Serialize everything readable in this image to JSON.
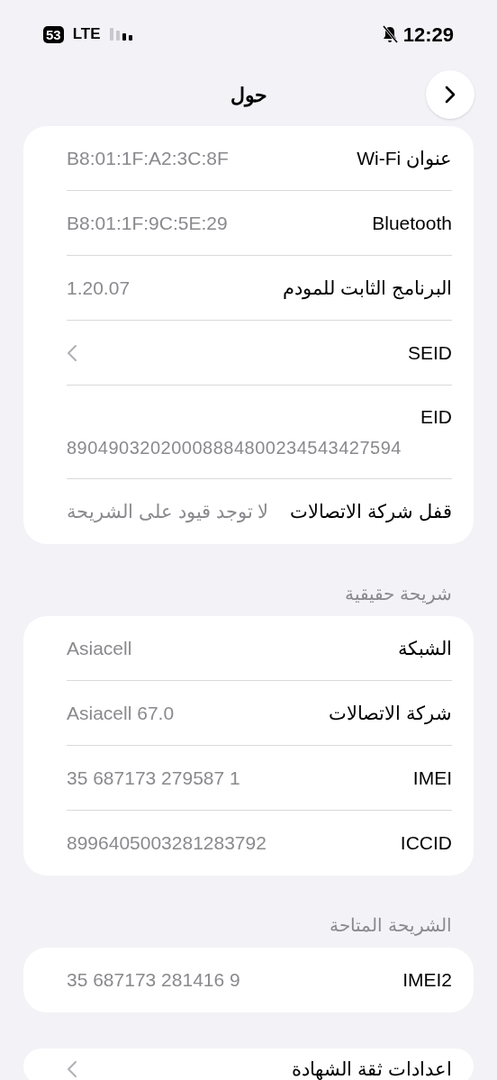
{
  "status_bar": {
    "battery": "53",
    "network": "LTE",
    "time": "12:29"
  },
  "nav": {
    "title": "حول"
  },
  "groups": [
    {
      "rows": [
        {
          "kind": "value",
          "label": "عنوان Wi-Fi",
          "value": "B8:01:1F:A2:3C:8F"
        },
        {
          "kind": "value",
          "label": "Bluetooth",
          "value": "B8:01:1F:9C:5E:29"
        },
        {
          "kind": "value",
          "label": "البرنامج الثابت للمودم",
          "value": "1.20.07"
        },
        {
          "kind": "link",
          "label": "SEID"
        },
        {
          "kind": "stacked",
          "label": "EID",
          "value": "89049032020008884800234543427594"
        },
        {
          "kind": "value",
          "label": "قفل شركة الاتصالات",
          "value": "لا توجد قيود على الشريحة"
        }
      ]
    },
    {
      "header": "شريحة حقيقية",
      "rows": [
        {
          "kind": "value",
          "label": "الشبكة",
          "value": "Asiacell"
        },
        {
          "kind": "value",
          "label": "شركة الاتصالات",
          "value": "Asiacell 67.0"
        },
        {
          "kind": "value",
          "label": "IMEI",
          "value": "35 687173 279587 1"
        },
        {
          "kind": "value",
          "label": "ICCID",
          "value": "8996405003281283792"
        }
      ]
    },
    {
      "header": "الشريحة المتاحة",
      "rows": [
        {
          "kind": "value",
          "label": "IMEI2",
          "value": "35 687173 281416 9"
        }
      ]
    },
    {
      "rows": [
        {
          "kind": "link",
          "label": "اعدادات ثقة الشهادة"
        }
      ]
    }
  ]
}
